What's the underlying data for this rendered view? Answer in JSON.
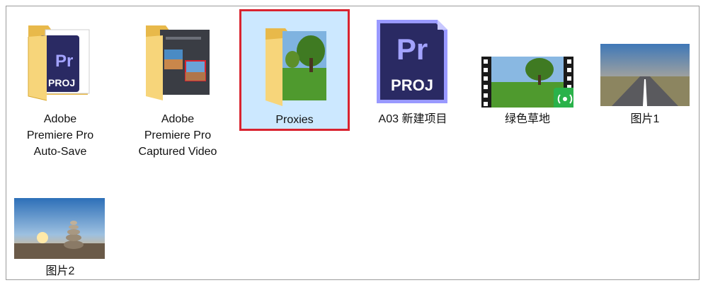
{
  "items": [
    {
      "name": "premiere-autosave-folder",
      "label_lines": [
        "Adobe",
        "Premiere Pro",
        "Auto-Save"
      ],
      "icon": "premiere-folder-icon"
    },
    {
      "name": "premiere-captured-folder",
      "label_lines": [
        "Adobe",
        "Premiere Pro",
        "Captured Video"
      ],
      "icon": "captured-video-folder-icon"
    },
    {
      "name": "proxies-folder",
      "label_lines": [
        "Proxies"
      ],
      "icon": "proxies-folder-icon",
      "selected": true
    },
    {
      "name": "a03-project-file",
      "label_lines": [
        "A03 新建项目"
      ],
      "icon": "premiere-proj-icon",
      "badge_top": "Pr",
      "badge_bottom": "PROJ"
    },
    {
      "name": "green-grass-video",
      "label_lines": [
        "绿色草地"
      ],
      "icon": "video-file-icon"
    },
    {
      "name": "image-1",
      "label_lines": [
        "图片1"
      ],
      "icon": "road-image-thumbnail"
    },
    {
      "name": "image-2",
      "label_lines": [
        "图片2"
      ],
      "icon": "stone-cairn-image-thumbnail"
    }
  ],
  "colors": {
    "selection_fill": "#cce8ff",
    "selection_border": "#d9232f",
    "premiere_purple": "#2a2a63",
    "premiere_accent": "#9999ff",
    "folder_yellow": "#f7d57a"
  }
}
